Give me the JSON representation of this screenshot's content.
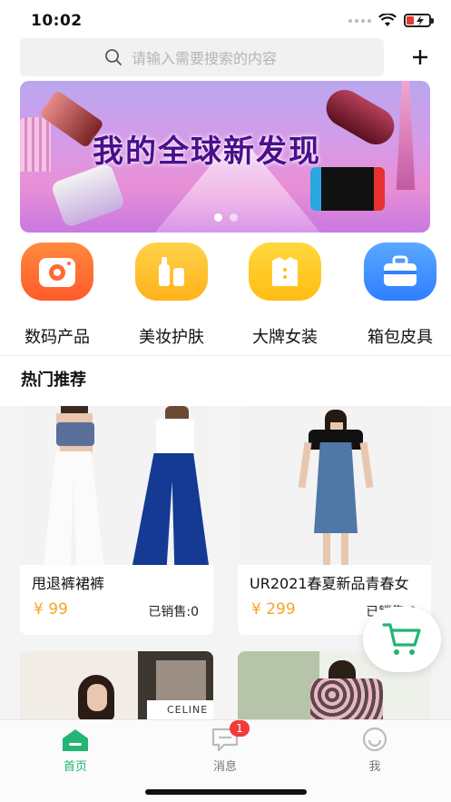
{
  "status_bar": {
    "time": "10:02"
  },
  "search": {
    "placeholder": "请输入需要搜索的内容"
  },
  "banner": {
    "title": "我的全球新发现",
    "page_count": 2,
    "active_index": 0
  },
  "categories": [
    {
      "label": "数码产品",
      "icon": "camera-icon",
      "color": "#ff6a33"
    },
    {
      "label": "美妆护肤",
      "icon": "cosmetics-icon",
      "color": "#ffbf1f"
    },
    {
      "label": "大牌女装",
      "icon": "shirt-icon",
      "color": "#ffc61a"
    },
    {
      "label": "箱包皮具",
      "icon": "toolbox-icon",
      "color": "#3c8dff"
    }
  ],
  "section": {
    "title": "热门推荐"
  },
  "products": [
    {
      "name": "甩退裤裙裤",
      "price": "¥ 99",
      "sold": "已销售:0"
    },
    {
      "name": "UR2021春夏新品青春女",
      "price": "¥ 299",
      "sold": "已销售:0"
    },
    {
      "name": "",
      "price": "",
      "sold": ""
    },
    {
      "name": "",
      "price": "",
      "sold": ""
    }
  ],
  "product_image_text": {
    "brand_tag": "CELINE"
  },
  "tab_bar": {
    "items": [
      {
        "label": "首页",
        "icon": "home-icon",
        "active": true
      },
      {
        "label": "消息",
        "icon": "message-icon",
        "badge": "1"
      },
      {
        "label": "我",
        "icon": "profile-icon"
      }
    ]
  },
  "colors": {
    "accent": "#22b573",
    "price": "#f5a623",
    "badge": "#f03a3a"
  }
}
